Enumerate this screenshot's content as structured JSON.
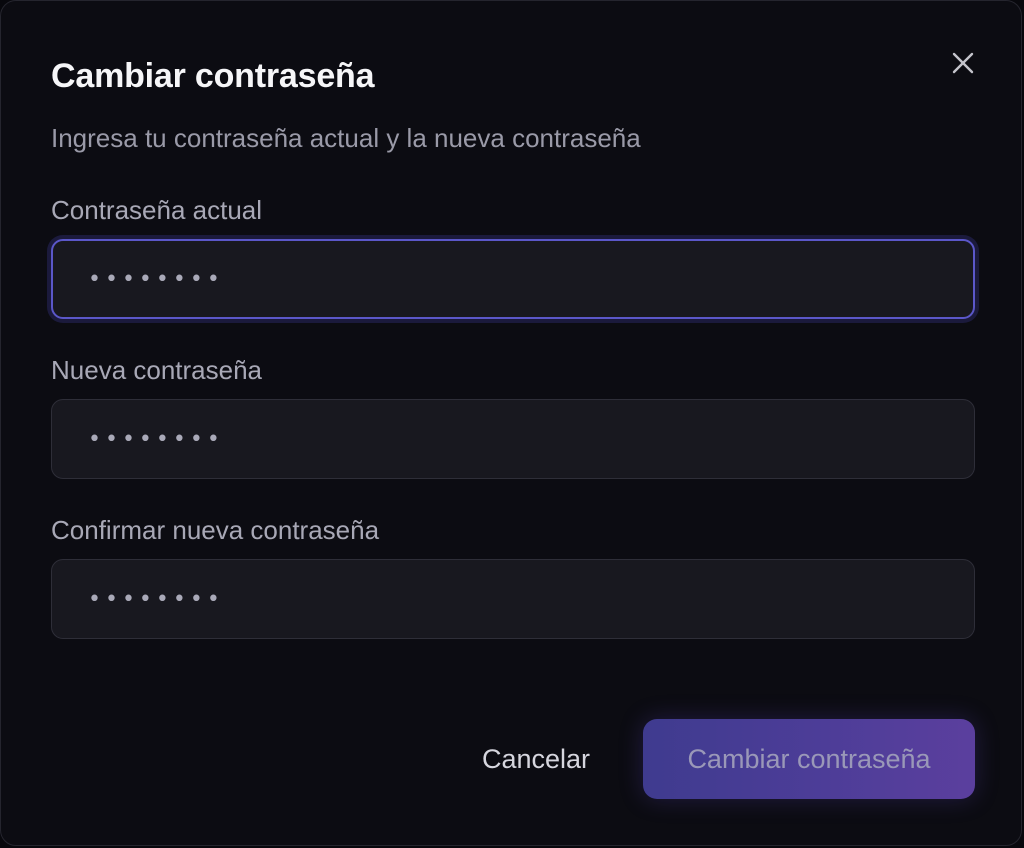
{
  "dialog": {
    "title": "Cambiar contraseña",
    "subtitle": "Ingresa tu contraseña actual y la nueva contraseña",
    "close_icon": "close-icon"
  },
  "fields": {
    "current_password": {
      "label": "Contraseña actual",
      "value": "••••••••",
      "focused": true
    },
    "new_password": {
      "label": "Nueva contraseña",
      "value": "••••••••"
    },
    "confirm_password": {
      "label": "Confirmar nueva contraseña",
      "value": "••••••••"
    }
  },
  "actions": {
    "cancel_label": "Cancelar",
    "submit_label": "Cambiar contraseña"
  },
  "colors": {
    "accent": "#5b57c9",
    "submit_gradient_start": "#3f3b8f",
    "submit_gradient_end": "#5b3f9e",
    "background": "#0c0c12"
  }
}
